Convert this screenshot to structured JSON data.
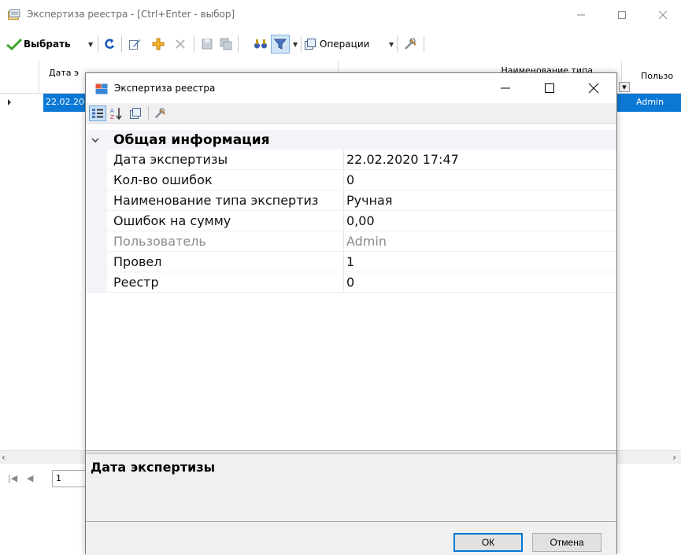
{
  "main_window": {
    "title": "Экспертиза реестра - [Ctrl+Enter - выбор]",
    "toolbar": {
      "select_label": "Выбрать",
      "operations_label": "Операции"
    },
    "grid": {
      "columns": [
        "Дата э",
        "Наименование типа",
        "Пользо"
      ],
      "selected_row": {
        "date": "22.02.20",
        "user": "Admin"
      }
    },
    "pager": {
      "page": "1"
    }
  },
  "dialog": {
    "title": "Экспертиза реестра",
    "category": "Общая информация",
    "properties": [
      {
        "name": "Дата экспертизы",
        "value": "22.02.2020 17:47"
      },
      {
        "name": "Кол-во ошибок",
        "value": "0"
      },
      {
        "name": "Наименование типа экспертиз",
        "value": "Ручная"
      },
      {
        "name": "Ошибок на сумму",
        "value": "0,00"
      },
      {
        "name": "Пользователь",
        "value": "Admin"
      },
      {
        "name": "Провел",
        "value": "1"
      },
      {
        "name": "Реестр",
        "value": "0"
      }
    ],
    "description_title": "Дата экспертизы",
    "ok_label": "ОК",
    "cancel_label": "Отмена"
  },
  "colors": {
    "selection": "#0b78d6",
    "ok_border": "#0078d7",
    "category_bg": "#f2f4f8"
  },
  "icons": [
    "window-icon",
    "checkmark-icon",
    "refresh-icon",
    "edit-icon",
    "add-icon",
    "delete-icon",
    "save-icon",
    "save-all-icon",
    "find-icon",
    "filter-icon",
    "operations-icon",
    "settings-icon",
    "categorized-icon",
    "sort-alpha-icon",
    "property-pages-icon"
  ]
}
